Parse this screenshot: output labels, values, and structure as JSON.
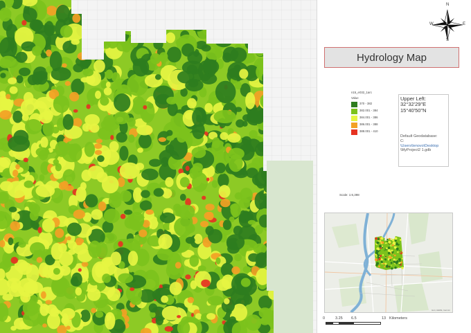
{
  "title": "Hydrology Map",
  "north_arrow": {
    "n": "N",
    "s": "S",
    "e": "E",
    "w": "W"
  },
  "legend": {
    "layer": "n15_e032_1arc",
    "field": "Value",
    "classes": [
      {
        "label": "370 - 382",
        "color": "#2e7d1e"
      },
      {
        "label": "382.001 - 384",
        "color": "#7cc21c"
      },
      {
        "label": "384.001 - 386",
        "color": "#e6f542"
      },
      {
        "label": "386.001 - 388",
        "color": "#f3a125"
      },
      {
        "label": "388.001 - 410",
        "color": "#e63222"
      }
    ]
  },
  "info": {
    "upper_left_label": "Upper Left:",
    "lon": "32°32'29\"E",
    "lat": "15°40'50\"N",
    "gdb_label": "Default Geodatabase:",
    "gdb_drive": "C:",
    "gdb_path": "\\Users\\lenovo\\Desktop",
    "gdb_file": "\\MyProject2 1.gdb"
  },
  "scale": "Scale: 1:6,398",
  "scalebar": {
    "ticks": [
      "0",
      "3.25",
      "6.5",
      "13"
    ],
    "unit": "Kilometers"
  },
  "inset_attribution": "Esri, HERE, Garmin"
}
